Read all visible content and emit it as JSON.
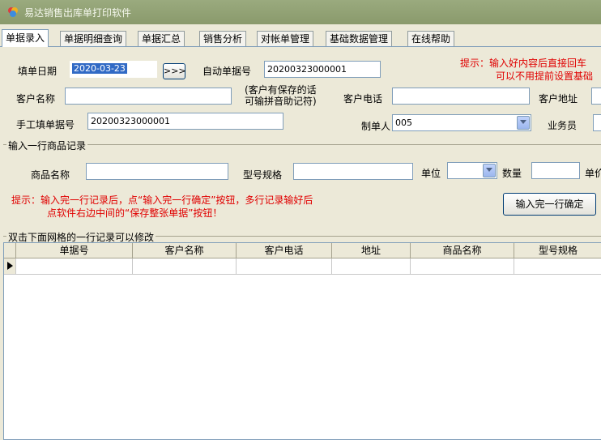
{
  "window": {
    "title": "易达销售出库单打印软件"
  },
  "tabs": [
    "单据录入",
    "单据明细查询",
    "单据汇总",
    "销售分析",
    "对帐单管理",
    "基础数据管理",
    "在线帮助"
  ],
  "form": {
    "date_label": "填单日期",
    "date_value": "2020-03-23",
    "date_button": ">>>",
    "auto_no_label": "自动单据号",
    "auto_no_value": "20200323000001",
    "tip_line1": "提示：输入好内容后直接回车",
    "tip_line2": "可以不用提前设置基础",
    "customer_label": "客户名称",
    "customer_hint_line1": "(客户有保存的话",
    "customer_hint_line2": "可输拼音助记符)",
    "phone_label": "客户电话",
    "address_label": "客户地址",
    "manual_no_label": "手工填单据号",
    "manual_no_value": "20200323000001",
    "maker_label": "制单人",
    "maker_value": "005",
    "salesman_label": "业务员"
  },
  "product": {
    "group_title": "输入一行商品记录",
    "name_label": "商品名称",
    "model_label": "型号规格",
    "unit_label": "单位",
    "qty_label": "数量",
    "price_label": "单价",
    "tip_line1": "提示：输入完一行记录后，点“输入完一行确定”按钮，多行记录输好后",
    "tip_line2": "点软件右边中间的“保存整张单据”按钮！",
    "confirm_button": "输入完一行确定"
  },
  "grid": {
    "group_title": "双击下面网格的一行记录可以修改",
    "columns": [
      "单据号",
      "客户名称",
      "客户电话",
      "地址",
      "商品名称",
      "型号规格"
    ]
  },
  "colors": {
    "tip_red": "#e00000",
    "titlebar": "#8a9a6c",
    "selection": "#316ac5"
  }
}
